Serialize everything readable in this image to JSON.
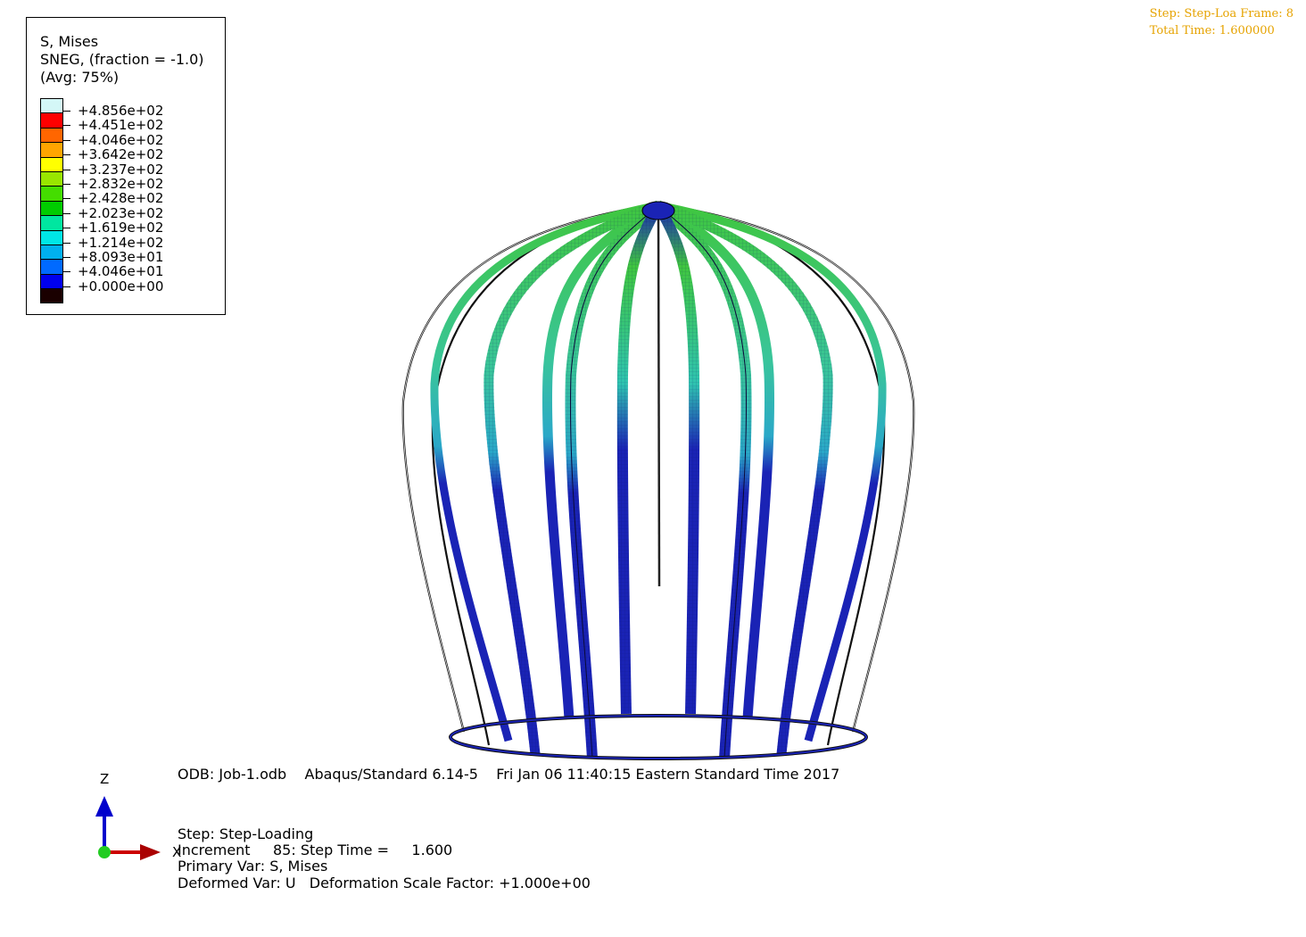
{
  "legend": {
    "title": "S, Mises",
    "subtitle": "SNEG, (fraction = -1.0)",
    "averaging": "(Avg: 75%)",
    "levels": [
      {
        "label": "+4.856e+02",
        "color": "#d4f7f7"
      },
      {
        "label": "+4.451e+02",
        "color": "#ff0000"
      },
      {
        "label": "+4.046e+02",
        "color": "#ff6600"
      },
      {
        "label": "+3.642e+02",
        "color": "#ffa500"
      },
      {
        "label": "+3.237e+02",
        "color": "#ffff00"
      },
      {
        "label": "+2.832e+02",
        "color": "#99e600"
      },
      {
        "label": "+2.428e+02",
        "color": "#44dd00"
      },
      {
        "label": "+2.023e+02",
        "color": "#00cc00"
      },
      {
        "label": "+1.619e+02",
        "color": "#00e6a0"
      },
      {
        "label": "+1.214e+02",
        "color": "#00e6e6"
      },
      {
        "label": "+8.093e+01",
        "color": "#00b0ee"
      },
      {
        "label": "+4.046e+01",
        "color": "#006aff"
      },
      {
        "label": "+0.000e+00",
        "color": "#0000ee"
      },
      {
        "label": "",
        "color": "#1a0000"
      }
    ]
  },
  "step_info": {
    "line1": "Step: Step-Loa Frame: 8",
    "line2": "Total Time: 1.600000"
  },
  "odb_info": {
    "odb": "ODB: Job-1.odb",
    "solver": "Abaqus/Standard 6.14-5",
    "date": "Fri Jan 06 11:40:15 Eastern Standard Time 2017",
    "step": "Step: Step-Loading",
    "increment": "Increment     85: Step Time =     1.600",
    "primary_var": "Primary Var: S, Mises",
    "deformed_var": "Deformed Var: U   Deformation Scale Factor: +1.000e+00"
  },
  "triad": {
    "z_label": "Z",
    "x_label": "X"
  },
  "colors": {
    "step_info": "#e6a300",
    "strut_low": "#1a23b5",
    "strut_mid": "#2aa8c8",
    "strut_high": "#3fc63f"
  }
}
